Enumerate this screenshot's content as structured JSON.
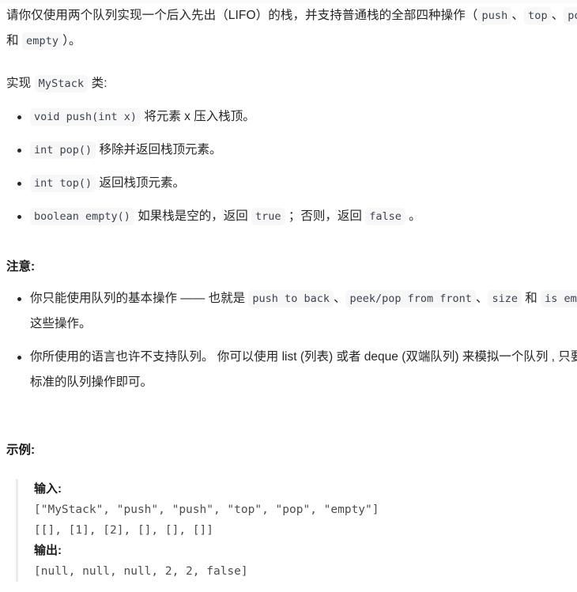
{
  "intro": {
    "line1_part1": "请你仅使用两个队列实现一个后入先出（LIFO）的栈，并支持普通栈的全部四种操作（",
    "code_push": "push",
    "sep1": "、",
    "code_top": "top",
    "sep2": "、",
    "code_pop": "pop",
    "sep3": " 和 ",
    "code_empty": "empty",
    "line1_end": "）。",
    "impl_prefix": "实现 ",
    "impl_class": "MyStack",
    "impl_suffix": " 类:"
  },
  "methods": [
    {
      "code": "void push(int x)",
      "text": " 将元素 x 压入栈顶。"
    },
    {
      "code": "int pop()",
      "text": " 移除并返回栈顶元素。"
    },
    {
      "code": "int top()",
      "text": " 返回栈顶元素。"
    },
    {
      "code": "boolean empty()",
      "text_a": " 如果栈是空的，返回 ",
      "code_true": "true",
      "text_b": " ；否则，返回 ",
      "code_false": "false",
      "text_c": " 。"
    }
  ],
  "notes": {
    "heading": "注意:",
    "item1": {
      "text_a": "你只能使用队列的基本操作 —— 也就是 ",
      "code_push_back": "push to back",
      "sep1": "、",
      "code_peek_pop": "peek/pop from front",
      "sep2": "、",
      "code_size": "size",
      "text_b": " 和 ",
      "code_is_empty": "is empty",
      "text_c": " 这些操作。"
    },
    "item2": "你所使用的语言也许不支持队列。 你可以使用 list  (列表) 或者 deque (双端队列) 来模拟一个队列 , 只要是标准的队列操作即可。"
  },
  "example": {
    "heading": "示例:",
    "input_label": "输入:",
    "input_line1": "[\"MyStack\", \"push\", \"push\", \"top\", \"pop\", \"empty\"]",
    "input_line2": "[[], [1], [2], [], [], []]",
    "output_label": "输出:",
    "output_line1": "[null, null, null, 2, 2, false]"
  },
  "colors": {
    "text": "#262626",
    "code_bg": "#f7f7f7",
    "code_text": "#3b4252",
    "quote_border": "#ebebeb",
    "page_bg": "#ffffff"
  }
}
